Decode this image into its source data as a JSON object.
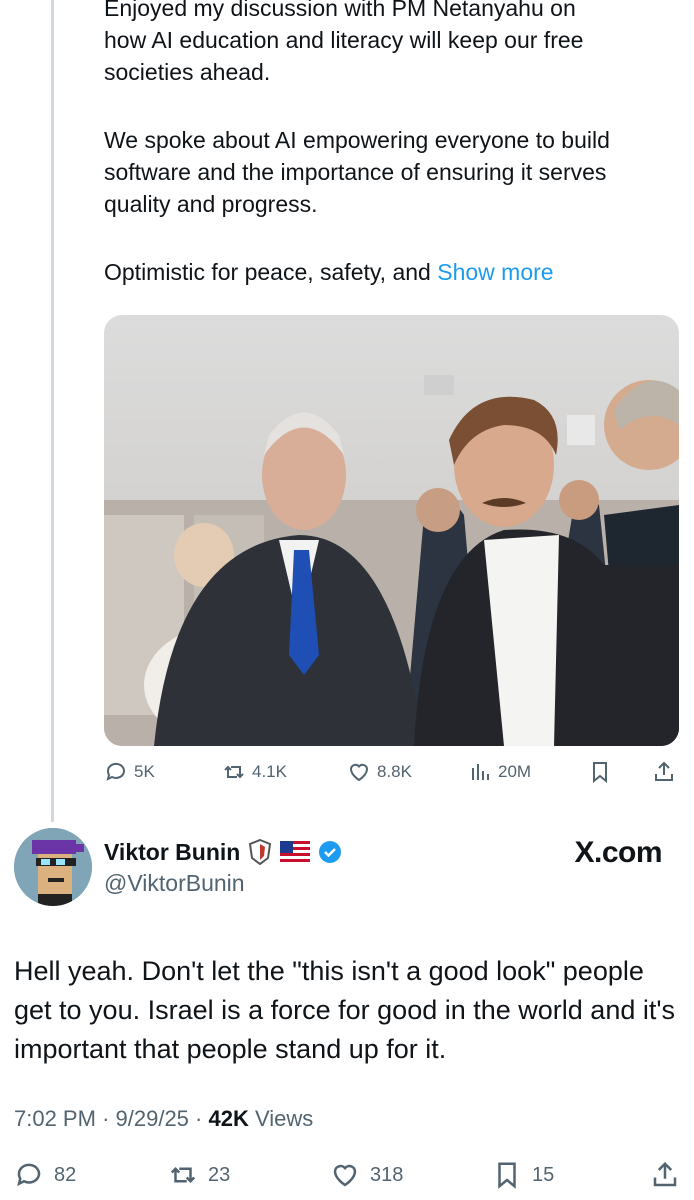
{
  "quoted_post": {
    "line1": "Enjoyed my discussion with PM Netanyahu on",
    "line2": "how AI education and literacy will keep our free",
    "line3": "societies ahead.",
    "para2_line1": "We spoke about AI empowering everyone to build",
    "para2_line2": "software and the importance of ensuring it serves",
    "para2_line3": "quality and progress.",
    "para3": "Optimistic for peace, safety, and ",
    "show_more": "Show more",
    "stats": {
      "replies": "5K",
      "reposts": "4.1K",
      "likes": "8.8K",
      "views": "20M"
    }
  },
  "reply_post": {
    "display_name": "Viktor Bunin",
    "handle": "@ViktorBunin",
    "source": "X.com",
    "text": "Hell yeah. Don't let the \"this isn't a good look\" people get to you. Israel is a force for good in the world and it's important that people stand up for it.",
    "time": "7:02 PM",
    "date": "9/29/25",
    "views_count": "42K",
    "views_label": "Views",
    "stats": {
      "replies": "82",
      "reposts": "23",
      "likes": "318",
      "bookmarks": "15"
    }
  },
  "colors": {
    "link": "#1d9bf0",
    "muted": "#536471",
    "verified": "#1d9bf0"
  },
  "icons": [
    "reply-icon",
    "repost-icon",
    "like-icon",
    "views-icon",
    "bookmark-icon",
    "share-icon",
    "verified-badge-icon",
    "us-flag-icon",
    "shield-badge-icon"
  ]
}
